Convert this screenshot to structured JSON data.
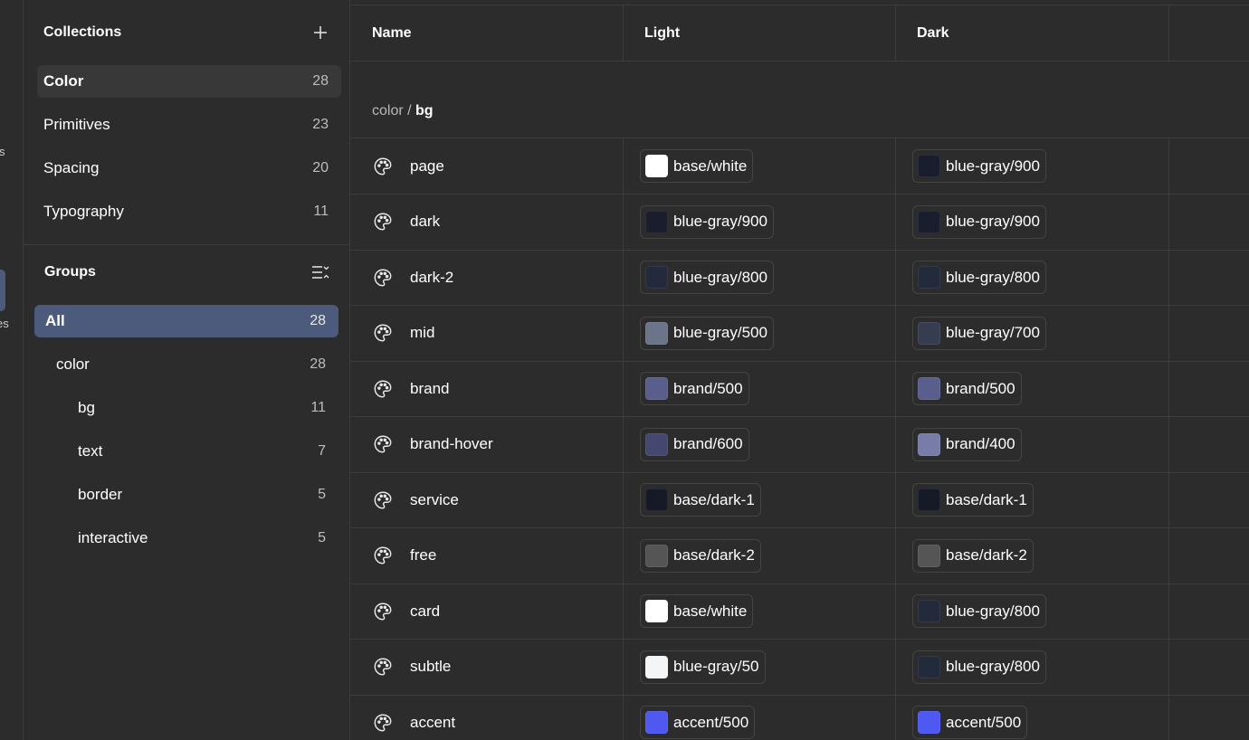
{
  "rail": {
    "fragments": [
      "s",
      "es"
    ]
  },
  "collections": {
    "title": "Collections",
    "add_icon": "plus-icon",
    "items": [
      {
        "label": "Color",
        "count": "28",
        "selected": true
      },
      {
        "label": "Primitives",
        "count": "23"
      },
      {
        "label": "Spacing",
        "count": "20"
      },
      {
        "label": "Typography",
        "count": "11"
      }
    ]
  },
  "groups": {
    "title": "Groups",
    "sort_icon": "collapse-list-icon",
    "items": [
      {
        "label": "All",
        "count": "28",
        "selected": true,
        "indent": 0
      },
      {
        "label": "color",
        "count": "28",
        "indent": 1
      },
      {
        "label": "bg",
        "count": "11",
        "indent": 2
      },
      {
        "label": "text",
        "count": "7",
        "indent": 2
      },
      {
        "label": "border",
        "count": "5",
        "indent": 2
      },
      {
        "label": "interactive",
        "count": "5",
        "indent": 2
      }
    ]
  },
  "table": {
    "columns": {
      "name": "Name",
      "light": "Light",
      "dark": "Dark"
    },
    "group_path": {
      "prefix": "color / ",
      "current": "bg"
    },
    "rows": [
      {
        "icon": "palette-icon",
        "name": "page",
        "light": {
          "label": "base/white",
          "color": "#ffffff"
        },
        "dark": {
          "label": "blue-gray/900",
          "color": "#191d2e"
        }
      },
      {
        "icon": "palette-icon",
        "name": "dark",
        "light": {
          "label": "blue-gray/900",
          "color": "#191d2e"
        },
        "dark": {
          "label": "blue-gray/900",
          "color": "#191d2e"
        }
      },
      {
        "icon": "palette-icon",
        "name": "dark-2",
        "light": {
          "label": "blue-gray/800",
          "color": "#232a3c"
        },
        "dark": {
          "label": "blue-gray/800",
          "color": "#232a3c"
        }
      },
      {
        "icon": "palette-icon",
        "name": "mid",
        "light": {
          "label": "blue-gray/500",
          "color": "#6b7488"
        },
        "dark": {
          "label": "blue-gray/700",
          "color": "#363d50"
        }
      },
      {
        "icon": "palette-icon",
        "name": "brand",
        "light": {
          "label": "brand/500",
          "color": "#5a5e8c"
        },
        "dark": {
          "label": "brand/500",
          "color": "#5a5e8c"
        }
      },
      {
        "icon": "palette-icon",
        "name": "brand-hover",
        "light": {
          "label": "brand/600",
          "color": "#44476f"
        },
        "dark": {
          "label": "brand/400",
          "color": "#787ca9"
        }
      },
      {
        "icon": "palette-icon",
        "name": "service",
        "light": {
          "label": "base/dark-1",
          "color": "#161a26"
        },
        "dark": {
          "label": "base/dark-1",
          "color": "#161a26"
        }
      },
      {
        "icon": "palette-icon",
        "name": "free",
        "light": {
          "label": "base/dark-2",
          "color": "#555555"
        },
        "dark": {
          "label": "base/dark-2",
          "color": "#555555"
        }
      },
      {
        "icon": "palette-icon",
        "name": "card",
        "light": {
          "label": "base/white",
          "color": "#ffffff"
        },
        "dark": {
          "label": "blue-gray/800",
          "color": "#232a3c"
        }
      },
      {
        "icon": "palette-icon",
        "name": "subtle",
        "light": {
          "label": "blue-gray/50",
          "color": "#f4f5f7"
        },
        "dark": {
          "label": "blue-gray/800",
          "color": "#232a3c"
        }
      },
      {
        "icon": "palette-icon",
        "name": "accent",
        "light": {
          "label": "accent/500",
          "color": "#4f58f0"
        },
        "dark": {
          "label": "accent/500",
          "color": "#4f58f0"
        }
      }
    ]
  }
}
